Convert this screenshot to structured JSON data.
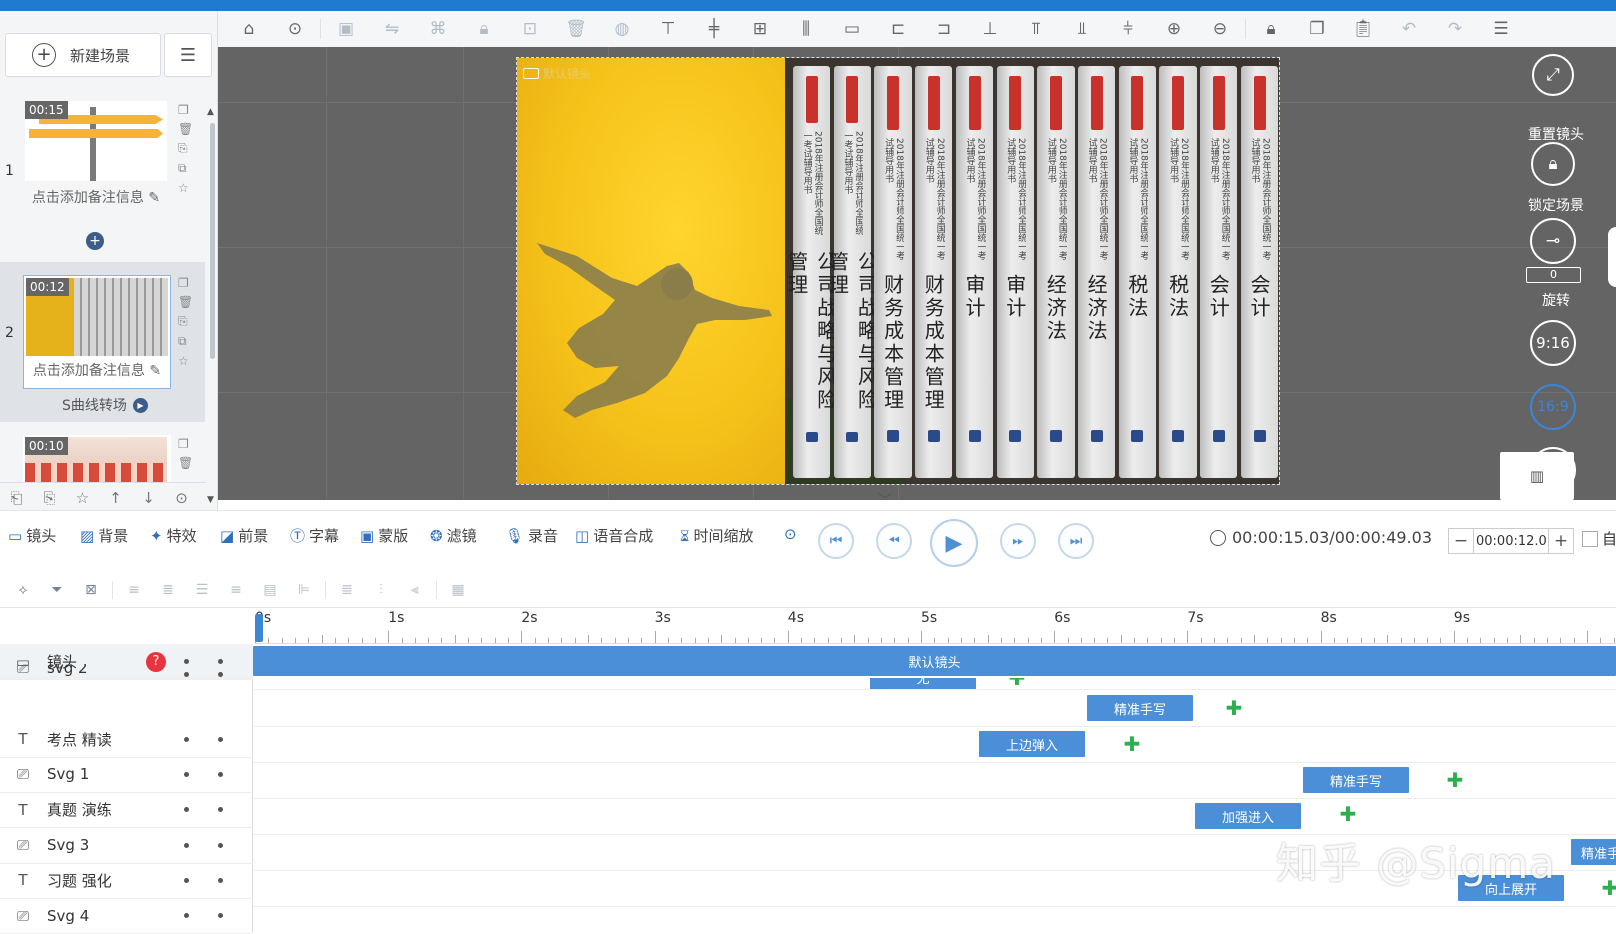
{
  "colors": {
    "accent": "#1e7bd0",
    "clip": "#4a8fd8",
    "keyframe": "#2bb04d",
    "help": "#e8343c"
  },
  "left_panel": {
    "new_scene_label": "新建场景",
    "scenes": [
      {
        "num": "1",
        "duration": "00:15",
        "note": "点击添加备注信息"
      },
      {
        "num": "2",
        "duration": "00:12",
        "note": "点击添加备注信息",
        "transition": "S曲线转场"
      },
      {
        "num": "",
        "duration": "00:10",
        "note": ""
      }
    ]
  },
  "stage": {
    "label": "默认镜头",
    "books": [
      {
        "big": "公司战略与风险管理",
        "sub": "2018年注册会计师全国统一考试辅导用书"
      },
      {
        "big": "公司战略与风险管理",
        "sub": "2018年注册会计师全国统一考试辅导用书"
      },
      {
        "big": "财务成本管理",
        "sub": "2018年注册会计师全国统一考试辅导用书"
      },
      {
        "big": "财务成本管理",
        "sub": "2018年注册会计师全国统一考试辅导用书"
      },
      {
        "big": "审计",
        "sub": "2018年注册会计师全国统一考试辅导用书"
      },
      {
        "big": "审计",
        "sub": "2018年注册会计师全国统一考试辅导用书"
      },
      {
        "big": "经济法",
        "sub": "2018年注册会计师全国统一考试辅导用书"
      },
      {
        "big": "经济法",
        "sub": "2018年注册会计师全国统一考试辅导用书"
      },
      {
        "big": "税法",
        "sub": "2018年注册会计师全国统一考试辅导用书"
      },
      {
        "big": "税法",
        "sub": "2018年注册会计师全国统一考试辅导用书"
      },
      {
        "big": "会计",
        "sub": "2018年注册会计师全国统一考试辅导用书"
      },
      {
        "big": "会计",
        "sub": "2018年注册会计师全国统一考试辅导用书"
      }
    ]
  },
  "right_tools": {
    "reset": "重置镜头",
    "lock": "锁定场景",
    "rotate": "旋转",
    "rotate_value": "0",
    "ratio1": "9:16",
    "ratio2": "16:9"
  },
  "modes": [
    "镜头",
    "背景",
    "特效",
    "前景",
    "字幕",
    "蒙版",
    "滤镜",
    "录音",
    "语音合成",
    "时间缩放"
  ],
  "playback": {
    "timecode": "00:00:15.03/00:00:49.03",
    "stepper_value": "00:00:12.0",
    "auto_label": "自"
  },
  "ruler": [
    "0s",
    "1s",
    "2s",
    "3s",
    "4s",
    "5s",
    "6s",
    "7s",
    "8s",
    "9s"
  ],
  "tracks": [
    {
      "name": "镜头",
      "icon": "camera-icon"
    },
    {
      "name": "svg 2",
      "icon": "svg-icon"
    },
    {
      "name": "考点 精读",
      "icon": "text-icon"
    },
    {
      "name": "Svg 1",
      "icon": "svg-icon"
    },
    {
      "name": "真题 演练",
      "icon": "text-icon"
    },
    {
      "name": "Svg 3",
      "icon": "svg-icon"
    },
    {
      "name": "习题 强化",
      "icon": "text-icon"
    },
    {
      "name": "Svg 4",
      "icon": "svg-icon"
    }
  ],
  "clips": {
    "camera": "默认镜头",
    "svg2": "无",
    "kaodian": "精准手写",
    "svg1": "上边弹入",
    "zhenti": "精准手写",
    "svg3": "加强进入",
    "xiti": "精准手",
    "svg4": "向上展开"
  },
  "watermark": "知乎 @Sigma"
}
